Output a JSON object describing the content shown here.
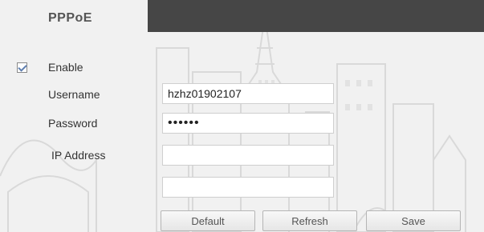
{
  "panel": {
    "title": "PPPoE"
  },
  "enable": {
    "label": "Enable",
    "checked": true
  },
  "username": {
    "label": "Username",
    "value": "hzhz01902107"
  },
  "password": {
    "label": "Password",
    "value": "••••••"
  },
  "ip_address": {
    "label": "IP Address",
    "value": "",
    "value_2": ""
  },
  "buttons": {
    "default": "Default",
    "refresh": "Refresh",
    "save": "Save"
  },
  "colors": {
    "header_bar": "#464646",
    "background": "#f1f1f1",
    "accent": "#5f7fb0"
  }
}
